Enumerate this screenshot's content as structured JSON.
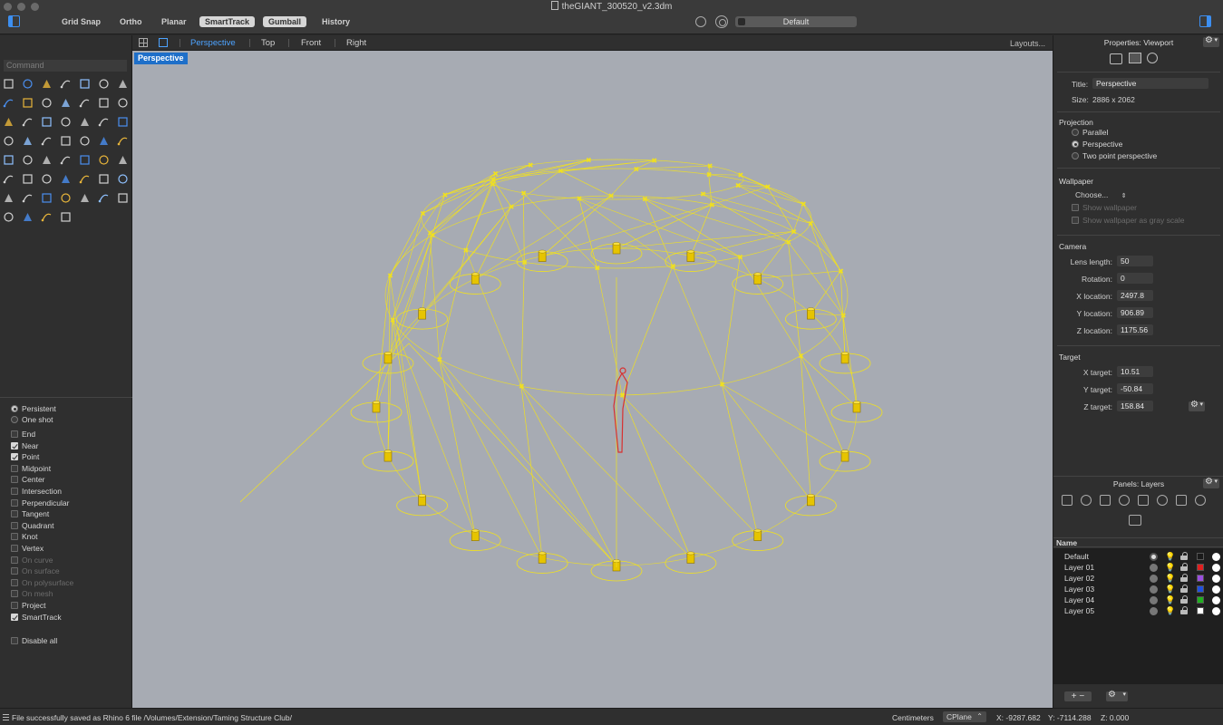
{
  "window": {
    "title": "theGIANT_300520_v2.3dm"
  },
  "toolbar": {
    "modes": [
      {
        "label": "Grid Snap",
        "on": false
      },
      {
        "label": "Ortho",
        "on": false
      },
      {
        "label": "Planar",
        "on": false
      },
      {
        "label": "SmartTrack",
        "on": true
      },
      {
        "label": "Gumball",
        "on": true
      },
      {
        "label": "History",
        "on": false
      }
    ],
    "layer_selector": "Default"
  },
  "command": {
    "placeholder": "Command"
  },
  "viewport_tabs": {
    "tabs": [
      "Perspective",
      "Top",
      "Front",
      "Right"
    ],
    "active": "Perspective",
    "layouts_label": "Layouts..."
  },
  "viewport": {
    "label": "Perspective",
    "accent": "#1e6fc9",
    "geometry_color": "#f0e020",
    "figure_color": "#d83030"
  },
  "osnap": {
    "mode_persistent": "Persistent",
    "mode_oneshot": "One shot",
    "items": [
      {
        "label": "End",
        "checked": false,
        "enabled": true
      },
      {
        "label": "Near",
        "checked": true,
        "enabled": true
      },
      {
        "label": "Point",
        "checked": true,
        "enabled": true
      },
      {
        "label": "Midpoint",
        "checked": false,
        "enabled": true
      },
      {
        "label": "Center",
        "checked": false,
        "enabled": true
      },
      {
        "label": "Intersection",
        "checked": false,
        "enabled": true
      },
      {
        "label": "Perpendicular",
        "checked": false,
        "enabled": true
      },
      {
        "label": "Tangent",
        "checked": false,
        "enabled": true
      },
      {
        "label": "Quadrant",
        "checked": false,
        "enabled": true
      },
      {
        "label": "Knot",
        "checked": false,
        "enabled": true
      },
      {
        "label": "Vertex",
        "checked": false,
        "enabled": true
      },
      {
        "label": "On curve",
        "checked": false,
        "enabled": false
      },
      {
        "label": "On surface",
        "checked": false,
        "enabled": false
      },
      {
        "label": "On polysurface",
        "checked": false,
        "enabled": false
      },
      {
        "label": "On mesh",
        "checked": false,
        "enabled": false
      },
      {
        "label": "Project",
        "checked": false,
        "enabled": true
      },
      {
        "label": "SmartTrack",
        "checked": true,
        "enabled": true
      }
    ],
    "disable_all": "Disable all"
  },
  "properties": {
    "panel_title": "Properties: Viewport",
    "title_label": "Title:",
    "title_value": "Perspective",
    "size_label": "Size:",
    "size_value": "2886 x 2062",
    "projection": {
      "header": "Projection",
      "options": [
        "Parallel",
        "Perspective",
        "Two point perspective"
      ],
      "selected": "Perspective"
    },
    "wallpaper": {
      "header": "Wallpaper",
      "choose": "Choose...",
      "show": "Show wallpaper",
      "gray": "Show wallpaper as gray scale"
    },
    "camera": {
      "header": "Camera",
      "lens_label": "Lens length:",
      "lens": "50",
      "rotation_label": "Rotation:",
      "rotation": "0",
      "x_label": "X location:",
      "x": "2497.8",
      "y_label": "Y location:",
      "y": "906.89",
      "z_label": "Z location:",
      "z": "1175.56"
    },
    "target": {
      "header": "Target",
      "x_label": "X target:",
      "x": "10.51",
      "y_label": "Y target:",
      "y": "-50.84",
      "z_label": "Z target:",
      "z": "158.84"
    }
  },
  "layers": {
    "panel_title": "Panels: Layers",
    "column_name": "Name",
    "rows": [
      {
        "name": "Default",
        "color": "#1a1a1a",
        "current": true
      },
      {
        "name": "Layer 01",
        "color": "#e02020",
        "current": false
      },
      {
        "name": "Layer 02",
        "color": "#9a4fe0",
        "current": false
      },
      {
        "name": "Layer 03",
        "color": "#2050e0",
        "current": false
      },
      {
        "name": "Layer 04",
        "color": "#20b020",
        "current": false
      },
      {
        "name": "Layer 05",
        "color": "#ffffff",
        "current": false
      }
    ],
    "add_label": "+ −"
  },
  "status": {
    "message": "File successfully saved as Rhino 6 file /Volumes/Extension/Taming Structure Club/",
    "units": "Centimeters",
    "cplane": "CPlane",
    "x": "X: -9287.682",
    "y": "Y: -7114.288",
    "z": "Z: 0.000"
  }
}
